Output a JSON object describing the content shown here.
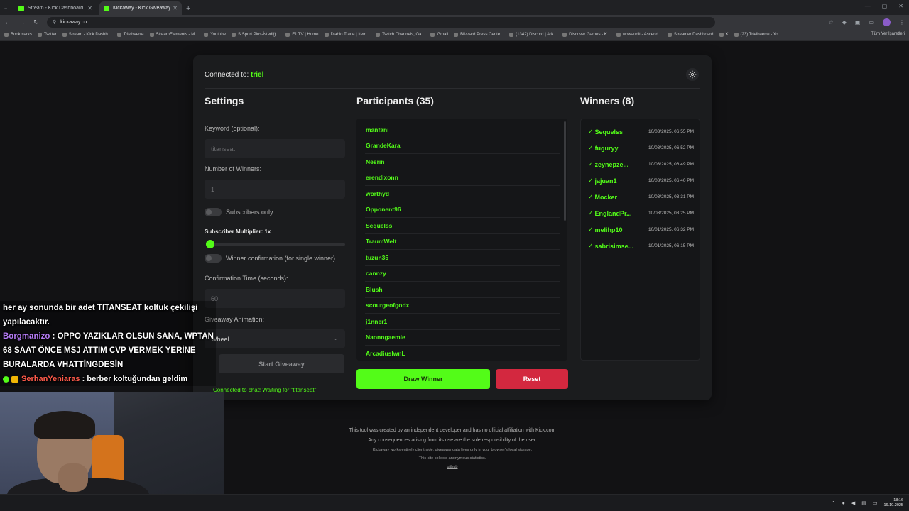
{
  "browser": {
    "tabs": [
      {
        "title": "Stream - Kick Dashboard",
        "active": false
      },
      {
        "title": "Kickaway - Kick Giveaway Tool",
        "active": true
      }
    ],
    "url": "kickaway.co",
    "bookmarks": [
      "Bookmarks",
      "Twitter",
      "Stream - Kick Dashb...",
      "Trielbaerre",
      "StreamElements - M...",
      "Youtube",
      "S Sport Plus-İstediği...",
      "F1 TV | Home",
      "Diablo Trade | Item...",
      "Twitch Channels, Ga...",
      "Gmail",
      "Blizzard Press Cente...",
      "(1342) Discord | Ark...",
      "Discover Games - K...",
      "wowaudit - Ascend...",
      "Streamer Dashboard",
      "X",
      "(23) Trielbaerre - Yo..."
    ],
    "bookmarks_right": "Tüm Yer İşaretleri"
  },
  "app": {
    "connected_label": "Connected to:",
    "connected_user": "triel",
    "settings": {
      "title": "Settings",
      "keyword_label": "Keyword (optional):",
      "keyword_value": "titanseat",
      "winners_label": "Number of Winners:",
      "winners_value": "1",
      "subscribers_only": "Subscribers only",
      "multiplier_label": "Subscriber Multiplier: 1x",
      "multiplier_value": 1,
      "winner_confirmation": "Winner confirmation (for single winner)",
      "confirmation_time_label": "Confirmation Time (seconds):",
      "confirmation_time_value": "60",
      "animation_label": "Giveaway Animation:",
      "animation_value": "Wheel",
      "start_button": "Start Giveaway",
      "chat_status": "Connected to chat! Waiting for \"titanseat\"."
    },
    "participants": {
      "title": "Participants (35)",
      "names": [
        "manfani",
        "GrandeKara",
        "Nesrin",
        "erendixonn",
        "worthyd",
        "Opponent96",
        "Sequelss",
        "TraumWelt",
        "tuzun35",
        "cannzy",
        "Blush",
        "scourgeofgodx",
        "j1nner1",
        "Naonngaemle",
        "ArcadiuslwnL"
      ]
    },
    "draw_button": "Draw Winner",
    "reset_button": "Reset",
    "winners": {
      "title": "Winners (8)",
      "list": [
        {
          "name": "Sequelss",
          "date": "10/03/2025, 06:55 PM"
        },
        {
          "name": "fuguryy",
          "date": "10/03/2025, 06:52 PM"
        },
        {
          "name": "zeynepze...",
          "date": "10/03/2025, 06:49 PM"
        },
        {
          "name": "jajuan1",
          "date": "10/03/2025, 06:40 PM"
        },
        {
          "name": "Mocker",
          "date": "10/03/2025, 03:31 PM"
        },
        {
          "name": "EnglandPr...",
          "date": "10/03/2025, 03:25 PM"
        },
        {
          "name": "melihp10",
          "date": "10/01/2025, 06:32 PM"
        },
        {
          "name": "sabrisimse...",
          "date": "10/01/2025, 06:15 PM"
        }
      ]
    },
    "footer": {
      "line1": "This tool was created by an independent developer and has no official affiliation with Kick.com",
      "line2": "Any consequences arising from its use are the sole responsibility of the user.",
      "line3": "Kickaway works entirely client-side; giveaway data lives only in your browser's local storage.",
      "line4": "This site collects anonymous statistics.",
      "link": "github"
    }
  },
  "stream_chat": [
    {
      "user": "",
      "text": "her ay sonunda bir adet TITANSEAT koltuk çekilişi yapılacaktır."
    },
    {
      "user": "Borgmanizo",
      "text": ": OPPO YAZIKLAR OLSUN SANA, WPTAN 68 SAAT ÖNCE MSJ ATTIM CVP VERMEK YERİNE BURALARDA VHATTİNGDESİN"
    },
    {
      "user": "SerhanYeniaras",
      "text": ": berber koltuğundan geldim"
    }
  ],
  "taskbar": {
    "time": "18:16",
    "date": "16.10.2025"
  },
  "colors": {
    "accent": "#53fc18",
    "danger": "#d3283f",
    "card": "#1b1c1e",
    "background": "#121214"
  }
}
